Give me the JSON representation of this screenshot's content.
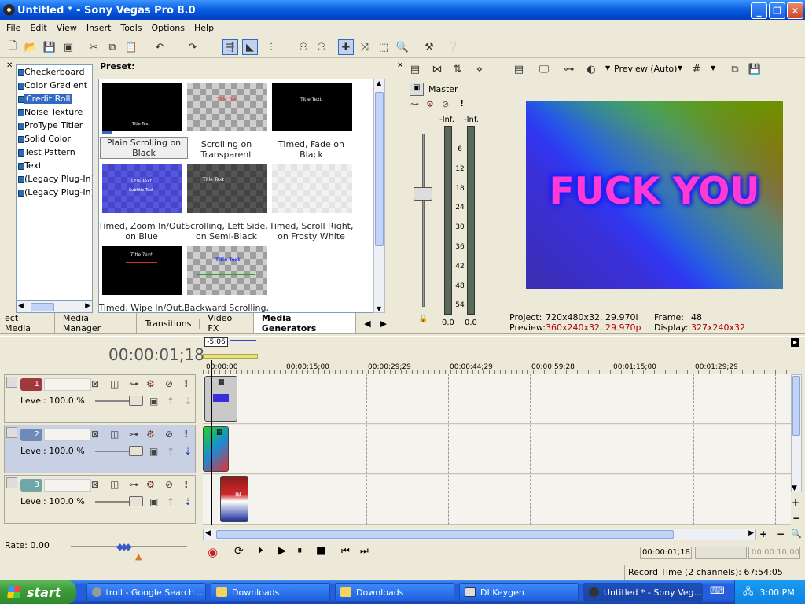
{
  "window": {
    "title": "Untitled * - Sony Vegas Pro 8.0"
  },
  "menu": [
    "File",
    "Edit",
    "View",
    "Insert",
    "Tools",
    "Options",
    "Help"
  ],
  "generators": {
    "items": [
      "Checkerboard",
      "Color Gradient",
      "Credit Roll",
      "Noise Texture",
      "ProType Titler",
      "Solid Color",
      "Test Pattern",
      "Text",
      "(Legacy Plug-In) T",
      "(Legacy Plug-In) V"
    ],
    "selected": "Credit Roll",
    "preset_label": "Preset:",
    "presets": [
      "Plain Scrolling on Black",
      "Scrolling on Transparent",
      "Timed, Fade on Black",
      "Timed, Zoom In/Out on Blue",
      "Scrolling, Left Side, on Semi-Black",
      "Timed, Scroll Right, on Frosty White",
      "Timed, Wipe In/Out,",
      "Backward Scrolling,"
    ],
    "thumb_texts": {
      "title": "Title Text",
      "subtitle": "Subtitle Text"
    }
  },
  "tabs": [
    "ect Media",
    "Media Manager",
    "Transitions",
    "Video FX",
    "Media Generators"
  ],
  "active_tab": "Media Generators",
  "mixer": {
    "label": "Master",
    "peak_left": "-Inf.",
    "peak_right": "-Inf.",
    "scale": [
      "6",
      "12",
      "18",
      "24",
      "30",
      "36",
      "42",
      "48",
      "54"
    ],
    "val_left": "0.0",
    "val_right": "0.0"
  },
  "preview": {
    "mode": "Preview (Auto)",
    "overlay_text": "FUCK YOU",
    "project_label": "Project:",
    "project_value": "720x480x32, 29.970i",
    "preview_label": "Preview:",
    "preview_value": "360x240x32, 29.970p",
    "frame_label": "Frame:",
    "frame_value": "48",
    "display_label": "Display:",
    "display_value": "327x240x32",
    "preview_color": "#b00000"
  },
  "timeline": {
    "timecode": "00:00:01;18",
    "marker": "-5;06",
    "ruler": [
      "00:00:00",
      "00:00:15;00",
      "00:00:29;29",
      "00:00:44;29",
      "00:00:59;28",
      "00:01:15;00",
      "00:01:29;29"
    ],
    "tracks": [
      {
        "num": "1",
        "level": "Level: 100.0 %"
      },
      {
        "num": "2",
        "level": "Level: 100.0 %"
      },
      {
        "num": "3",
        "level": "Level: 100.0 %"
      }
    ],
    "rate": "Rate: 0.00",
    "cursor_time": "00:00:01;18",
    "end_time": "00:00:10;00",
    "record_time": "Record Time (2 channels): 67:54:05"
  },
  "taskbar": {
    "start": "start",
    "items": [
      "troll - Google Search ...",
      "Downloads",
      "Downloads",
      "DI Keygen",
      "Untitled * - Sony Veg..."
    ],
    "clock": "3:00 PM"
  }
}
